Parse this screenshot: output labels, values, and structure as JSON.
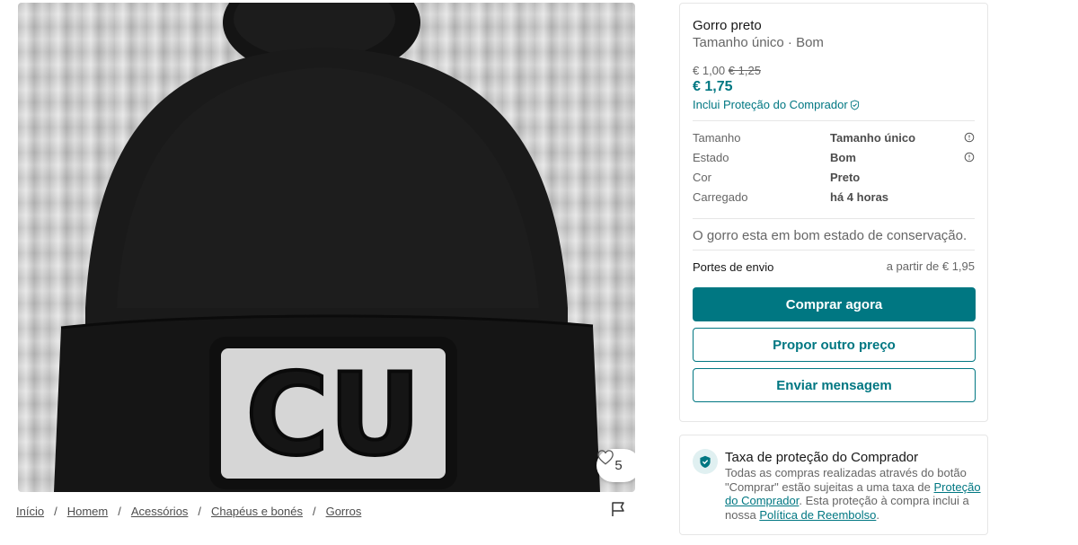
{
  "colors": {
    "accent": "#007782",
    "text_muted": "#666666",
    "border": "#e6e6e6"
  },
  "photo": {
    "alt": "Gorro preto com emblema",
    "patch_text": "CU",
    "likes": "5",
    "like_icon": "heart-icon"
  },
  "breadcrumb": [
    "Início",
    "Homem",
    "Acessórios",
    "Chapéus e bonés",
    "Gorros"
  ],
  "breadcrumb_separator": "/",
  "report_icon": "flag-icon",
  "item": {
    "title": "Gorro preto",
    "subtitle": "Tamanho único · Bom",
    "price": "€ 1,00",
    "price_original": "€ 1,25",
    "price_with_protection": "€ 1,75",
    "protection_label": "Inclui Proteção do Comprador"
  },
  "details": [
    {
      "label": "Tamanho",
      "value": "Tamanho único",
      "info": true
    },
    {
      "label": "Estado",
      "value": "Bom",
      "info": true
    },
    {
      "label": "Cor",
      "value": "Preto",
      "info": false
    },
    {
      "label": "Carregado",
      "value": "há 4 horas",
      "info": false
    }
  ],
  "description": "O gorro esta em bom estado de conservação.",
  "shipping": {
    "label": "Portes de envio",
    "value": "a partir de € 1,95"
  },
  "buttons": {
    "buy": "Comprar agora",
    "offer": "Propor outro preço",
    "message": "Enviar mensagem"
  },
  "fee": {
    "title": "Taxa de proteção do Comprador",
    "text_1": "Todas as compras realizadas através do botão \"Comprar\" estão sujeitas a uma taxa de ",
    "link_1": "Proteção do Comprador",
    "text_2": ". Esta proteção à compra inclui a nossa ",
    "link_2": "Política de Reembolso",
    "text_3": "."
  }
}
